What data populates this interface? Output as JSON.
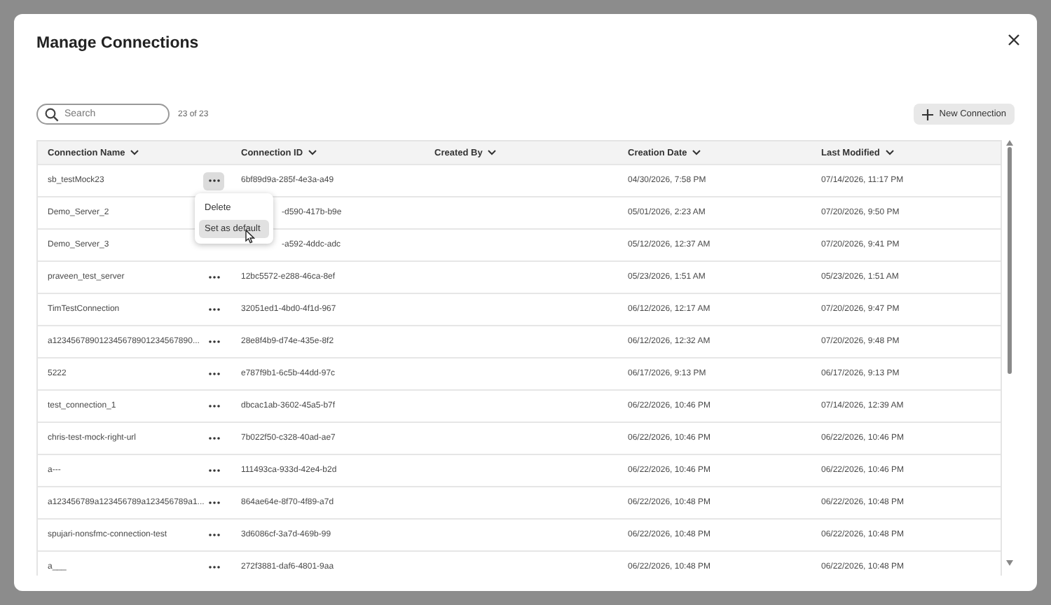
{
  "dialog": {
    "title": "Manage Connections"
  },
  "search": {
    "placeholder": "Search"
  },
  "result_count": "23 of 23",
  "new_button": {
    "label": "New Connection"
  },
  "table": {
    "columns": [
      "Connection Name",
      "Connection ID",
      "Created By",
      "Creation Date",
      "Last Modified"
    ],
    "rows": [
      {
        "name": "sb_testMock23",
        "id": "6bf89d9a-285f-4e3a-a49",
        "created_by": "",
        "created": "04/30/2026, 7:58 PM",
        "modified": "07/14/2026, 11:17 PM",
        "menu_open": true
      },
      {
        "name": "Demo_Server_2",
        "id": "-d590-417b-b9e",
        "created_by": "",
        "created": "05/01/2026, 2:23 AM",
        "modified": "07/20/2026, 9:50 PM",
        "menu_open": false
      },
      {
        "name": "Demo_Server_3",
        "id": "-a592-4ddc-adc",
        "created_by": "",
        "created": "05/12/2026, 12:37 AM",
        "modified": "07/20/2026, 9:41 PM",
        "menu_open": false
      },
      {
        "name": "praveen_test_server",
        "id": "12bc5572-e288-46ca-8ef",
        "created_by": "",
        "created": "05/23/2026, 1:51 AM",
        "modified": "05/23/2026, 1:51 AM",
        "menu_open": false
      },
      {
        "name": "TimTestConnection",
        "id": "32051ed1-4bd0-4f1d-967",
        "created_by": "",
        "created": "06/12/2026, 12:17 AM",
        "modified": "07/20/2026, 9:47 PM",
        "menu_open": false
      },
      {
        "name": "a123456789012345678901234567890...",
        "id": "28e8f4b9-d74e-435e-8f2",
        "created_by": "",
        "created": "06/12/2026, 12:32 AM",
        "modified": "07/20/2026, 9:48 PM",
        "menu_open": false
      },
      {
        "name": "5222",
        "id": "e787f9b1-6c5b-44dd-97c",
        "created_by": "",
        "created": "06/17/2026, 9:13 PM",
        "modified": "06/17/2026, 9:13 PM",
        "menu_open": false
      },
      {
        "name": "test_connection_1",
        "id": "dbcac1ab-3602-45a5-b7f",
        "created_by": "",
        "created": "06/22/2026, 10:46 PM",
        "modified": "07/14/2026, 12:39 AM",
        "menu_open": false
      },
      {
        "name": "chris-test-mock-right-url",
        "id": "7b022f50-c328-40ad-ae7",
        "created_by": "",
        "created": "06/22/2026, 10:46 PM",
        "modified": "06/22/2026, 10:46 PM",
        "menu_open": false
      },
      {
        "name": "a---",
        "id": "111493ca-933d-42e4-b2d",
        "created_by": "",
        "created": "06/22/2026, 10:46 PM",
        "modified": "06/22/2026, 10:46 PM",
        "menu_open": false
      },
      {
        "name": "a123456789a123456789a123456789a1...",
        "id": "864ae64e-8f70-4f89-a7d",
        "created_by": "",
        "created": "06/22/2026, 10:48 PM",
        "modified": "06/22/2026, 10:48 PM",
        "menu_open": false
      },
      {
        "name": "spujari-nonsfmc-connection-test",
        "id": "3d6086cf-3a7d-469b-99",
        "created_by": "",
        "created": "06/22/2026, 10:48 PM",
        "modified": "06/22/2026, 10:48 PM",
        "menu_open": false
      },
      {
        "name": "a___",
        "id": "272f3881-daf6-4801-9aa",
        "created_by": "",
        "created": "06/22/2026, 10:48 PM",
        "modified": "06/22/2026, 10:48 PM",
        "menu_open": false
      }
    ]
  },
  "row_menu": {
    "items": [
      {
        "label": "Delete",
        "hovered": false
      },
      {
        "label": "Set as default",
        "hovered": true
      }
    ]
  }
}
